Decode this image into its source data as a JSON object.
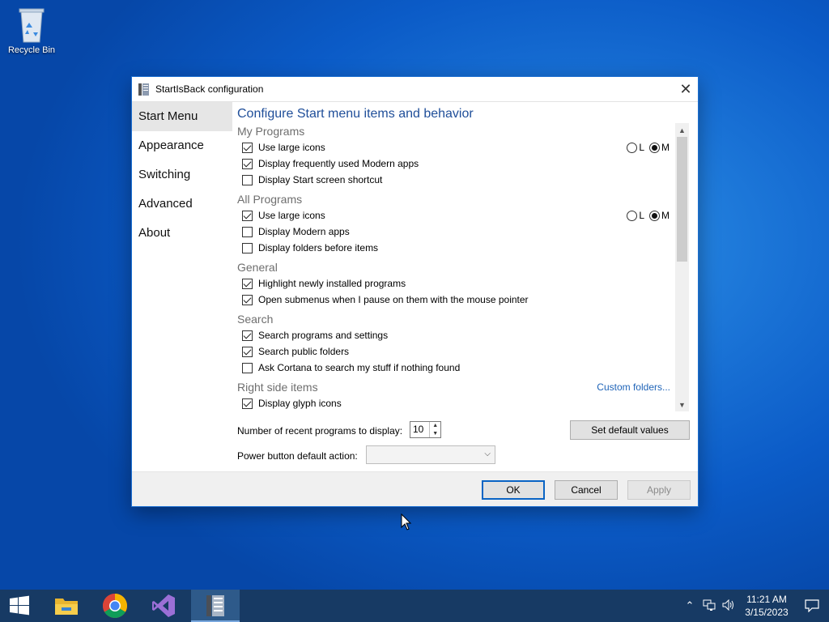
{
  "desktop": {
    "recycle_bin_label": "Recycle Bin"
  },
  "window": {
    "title": "StartIsBack configuration",
    "sidebar": [
      {
        "label": "Start Menu",
        "active": true
      },
      {
        "label": "Appearance",
        "active": false
      },
      {
        "label": "Switching",
        "active": false
      },
      {
        "label": "Advanced",
        "active": false
      },
      {
        "label": "About",
        "active": false
      }
    ],
    "heading": "Configure Start menu items and behavior",
    "sections": {
      "my_programs": {
        "title": "My Programs",
        "items": [
          {
            "label": "Use large icons",
            "checked": true
          },
          {
            "label": "Display frequently used Modern apps",
            "checked": true
          },
          {
            "label": "Display Start screen shortcut",
            "checked": false
          }
        ],
        "radio_l": "L",
        "radio_m": "M",
        "radio_selected": "M"
      },
      "all_programs": {
        "title": "All Programs",
        "items": [
          {
            "label": "Use large icons",
            "checked": true
          },
          {
            "label": "Display Modern apps",
            "checked": false
          },
          {
            "label": "Display folders before items",
            "checked": false
          }
        ],
        "radio_l": "L",
        "radio_m": "M",
        "radio_selected": "M"
      },
      "general": {
        "title": "General",
        "items": [
          {
            "label": "Highlight newly installed programs",
            "checked": true
          },
          {
            "label": "Open submenus when I pause on them with the mouse pointer",
            "checked": true
          }
        ]
      },
      "search": {
        "title": "Search",
        "items": [
          {
            "label": "Search programs and settings",
            "checked": true
          },
          {
            "label": "Search public folders",
            "checked": true
          },
          {
            "label": "Ask Cortana to search my stuff if nothing found",
            "checked": false
          }
        ]
      },
      "right_side": {
        "title": "Right side items",
        "link": "Custom folders...",
        "items": [
          {
            "label": "Display glyph icons",
            "checked": true
          }
        ]
      }
    },
    "recent_programs_label": "Number of recent programs to display:",
    "recent_programs_value": "10",
    "set_default_label": "Set default values",
    "power_button_label": "Power button default action:",
    "power_button_value": "",
    "buttons": {
      "ok": "OK",
      "cancel": "Cancel",
      "apply": "Apply"
    }
  },
  "taskbar": {
    "apps": [
      "start-icon",
      "file-explorer-icon",
      "chrome-icon",
      "visual-studio-icon",
      "startisback-config-icon"
    ],
    "time": "11:21 AM",
    "date": "3/15/2023"
  },
  "colors": {
    "accent": "#0a64c4",
    "heading": "#1f4e99",
    "taskbar": "#173a64"
  }
}
